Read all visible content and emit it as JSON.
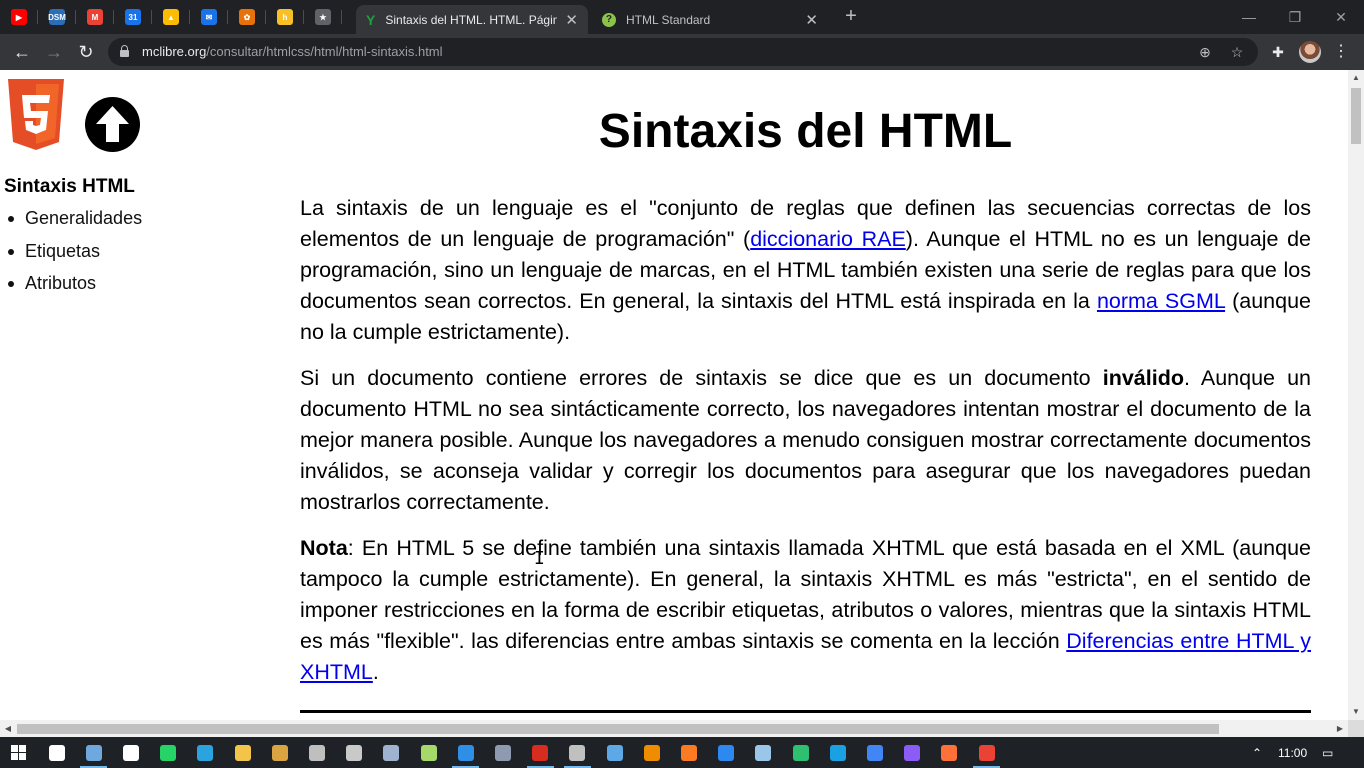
{
  "browser": {
    "pinned_tabs": [
      {
        "icon": "youtube-icon",
        "color": "#ff0000",
        "glyph": "▶"
      },
      {
        "icon": "dsm-icon",
        "color": "#2a6db8",
        "glyph": "DSM"
      },
      {
        "icon": "gmail-icon",
        "color": "#ea4335",
        "glyph": "M"
      },
      {
        "icon": "calendar-icon",
        "color": "#1a73e8",
        "glyph": "31"
      },
      {
        "icon": "drive-icon",
        "color": "#fbbc04",
        "glyph": "▲"
      },
      {
        "icon": "mail-icon",
        "color": "#1a73e8",
        "glyph": "✉"
      },
      {
        "icon": "photos-icon",
        "color": "#e8710a",
        "glyph": "✿"
      },
      {
        "icon": "bookmark-app-icon",
        "color": "#f6c026",
        "glyph": "h"
      },
      {
        "icon": "star-app-icon",
        "color": "#5f6368",
        "glyph": "★"
      }
    ],
    "tabs": [
      {
        "title": "Sintaxis del HTML. HTML. Páginas web",
        "icon": "mclibre-icon",
        "active": true
      },
      {
        "title": "HTML Standard",
        "icon": "whatwg-icon",
        "active": false
      }
    ],
    "new_tab": "+",
    "window_controls": {
      "minimize": "—",
      "restore": "❐",
      "close": "✕"
    },
    "url_host": "mclibre.org",
    "url_path": "/consultar/htmlcss/html/html-sintaxis.html"
  },
  "page": {
    "sidebar": {
      "title": "Sintaxis HTML",
      "items": [
        "Generalidades",
        "Etiquetas",
        "Atributos"
      ]
    },
    "title": "Sintaxis del HTML",
    "p1": {
      "t1": "La sintaxis de un lenguaje es el \"conjunto de reglas que definen las secuencias correctas de los elementos de un lenguaje de programación\" (",
      "link1": "diccionario RAE",
      "t2": "). Aunque el HTML no es un lenguaje de programación, sino un lenguaje de marcas, en el HTML también existen una serie de reglas para que los documentos sean correctos. En general, la sintaxis del HTML está inspirada en la ",
      "link2": "norma SGML",
      "t3": " (aunque no la cumple estrictamente)."
    },
    "p2": {
      "t1": "Si un documento contiene errores de sintaxis se dice que es un documento ",
      "bold": "inválido",
      "t2": ". Aunque un documento HTML no sea sintácticamente correcto, los navegadores intentan mostrar el documento de la mejor manera posible. Aunque los navegadores a menudo consiguen mostrar correctamente documentos inválidos, se aconseja validar y corregir los documentos para asegurar que los navegadores puedan mostrarlos correctamente."
    },
    "p3": {
      "bold": "Nota",
      "t1": ": En HTML 5 se define también una sintaxis llamada XHTML que está basada en el XML (aunque tampoco la cumple estrictamente). En general, la sintaxis XHTML es más \"estricta\", en el sentido de imponer restricciones en la forma de escribir etiquetas, atributos o valores, mientras que la sintaxis HTML es más \"flexible\". las diferencias entre ambas sintaxis se comenta en la lección ",
      "link": "Diferencias entre HTML y XHTML",
      "t2": "."
    }
  },
  "taskbar": {
    "apps": [
      {
        "icon": "task-view-icon",
        "color": "#ffffff"
      },
      {
        "icon": "keyboard-icon",
        "color": "#6fa8dc"
      },
      {
        "icon": "settings-app-icon",
        "color": "#ffffff"
      },
      {
        "icon": "whatsapp-icon",
        "color": "#25d366"
      },
      {
        "icon": "telegram-icon",
        "color": "#2aa3df"
      },
      {
        "icon": "file-explorer-icon",
        "color": "#f3c44a"
      },
      {
        "icon": "library-icon",
        "color": "#d9a441"
      },
      {
        "icon": "terminal-icon",
        "color": "#bfbfbf"
      },
      {
        "icon": "gamepad-icon",
        "color": "#c9c9c9"
      },
      {
        "icon": "document-icon",
        "color": "#9fb3d1"
      },
      {
        "icon": "notepad-icon",
        "color": "#a6d96a"
      },
      {
        "icon": "vscode-icon",
        "color": "#2f8ee5"
      },
      {
        "icon": "menu-app-icon",
        "color": "#8e9aaf"
      },
      {
        "icon": "filezilla-icon",
        "color": "#d62d20"
      },
      {
        "icon": "clock-app-icon",
        "color": "#c0c0c0"
      },
      {
        "icon": "cube-icon",
        "color": "#5fa8e8"
      },
      {
        "icon": "vlc-icon",
        "color": "#f08c00"
      },
      {
        "icon": "xampp-icon",
        "color": "#fb7a24"
      },
      {
        "icon": "media-player-icon",
        "color": "#2d89ef"
      },
      {
        "icon": "remote-desktop-icon",
        "color": "#9ac6ea"
      },
      {
        "icon": "edge-icon",
        "color": "#2fbf71"
      },
      {
        "icon": "ie-icon",
        "color": "#1ba1e2"
      },
      {
        "icon": "chrome-alt-icon",
        "color": "#4285f4"
      },
      {
        "icon": "firefox-dev-icon",
        "color": "#8b5cf6"
      },
      {
        "icon": "firefox-icon",
        "color": "#ff7139"
      },
      {
        "icon": "chrome-icon",
        "color": "#ea4335"
      }
    ],
    "time": "11:00"
  }
}
